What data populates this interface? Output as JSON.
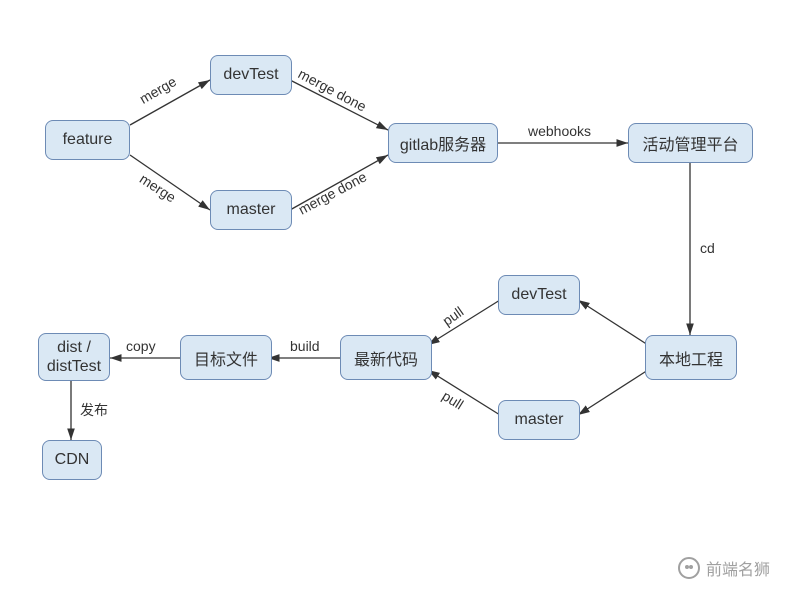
{
  "nodes": {
    "feature": "feature",
    "devTest1": "devTest",
    "master1": "master",
    "gitlab": "gitlab服务器",
    "platform": "活动管理平台",
    "local": "本地工程",
    "devTest2": "devTest",
    "master2": "master",
    "latest": "最新代码",
    "target": "目标文件",
    "dist": "dist /\ndistTest",
    "cdn": "CDN"
  },
  "edges": {
    "merge1": "merge",
    "merge2": "merge",
    "mergeDone1": "merge done",
    "mergeDone2": "merge done",
    "webhooks": "webhooks",
    "cd": "cd",
    "pull1": "pull",
    "pull2": "pull",
    "build": "build",
    "copy": "copy",
    "publish": "发布"
  },
  "watermark": "前端名狮"
}
